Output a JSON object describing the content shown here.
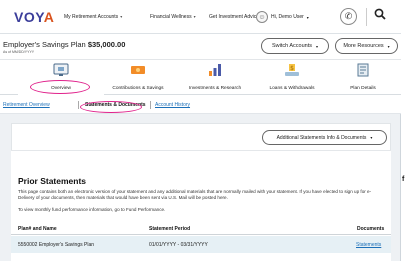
{
  "topnav": {
    "logo_prefix": "VOY",
    "logo_accent": "A",
    "links": [
      "My Retirement Accounts",
      "Financial Wellness",
      "Get Investment Advice"
    ],
    "user": "Hi, Demo User"
  },
  "plan": {
    "name": "Employer's Savings Plan",
    "balance": "$35,000.00",
    "as_of": "As of MM/DD/YYYY",
    "switch_label": "Switch Accounts",
    "more_label": "More Resources"
  },
  "tabs": [
    {
      "label": "Overview",
      "icon": "home-screen-icon"
    },
    {
      "label": "Contributions & Savings",
      "icon": "money-icon"
    },
    {
      "label": "Investments & Research",
      "icon": "bar-chart-icon"
    },
    {
      "label": "Loans & Withdrawals",
      "icon": "hand-money-icon"
    },
    {
      "label": "Plan Details",
      "icon": "document-icon"
    }
  ],
  "subtabs": [
    "Retirement Overview",
    "Statements & Documents",
    "Account History"
  ],
  "additional_label": "Additional Statements Info & Documents",
  "prior": {
    "title": "Prior Statements",
    "description": "This page contains both an electronic version of your statement and any additional materials that are normally mailed with your statement. If you have elected to sign up for e-Delivery of your documents, then materials that would have been sent via U.S. Mail will be posted here.",
    "view_text": "To view monthly fund performance information, go to Fund Performance.",
    "columns": [
      "Plan# and Name",
      "Statement Period",
      "Documents"
    ],
    "rows": [
      {
        "plan": "5550002 Employer's Savings Plan",
        "period": "01/01/YYYY - 03/31/YYYY",
        "doc": "Statements"
      }
    ]
  },
  "edge_char": "f",
  "colors": {
    "highlight": "#e0238c",
    "link": "#1b6fb8",
    "brand": "#3b3d9a",
    "accent": "#d9531e"
  }
}
